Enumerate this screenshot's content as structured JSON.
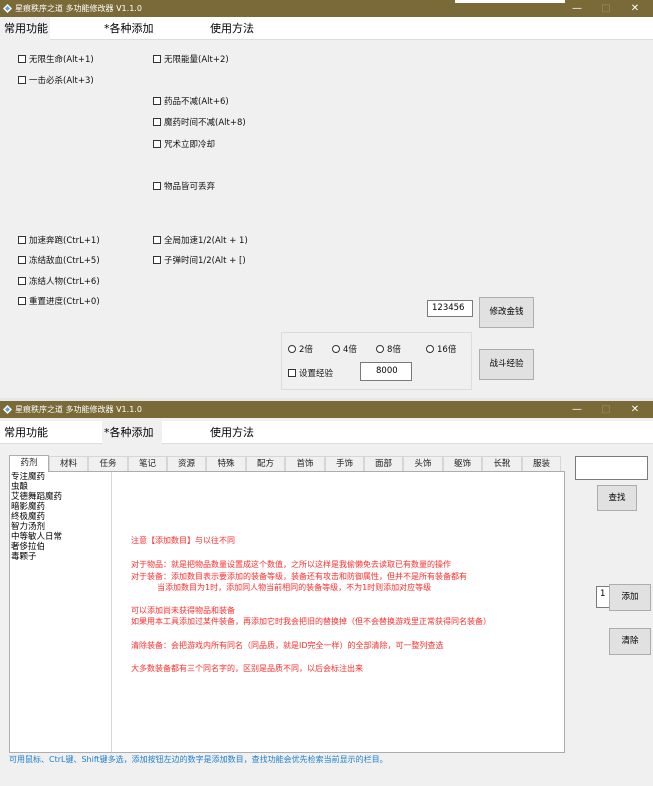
{
  "window1": {
    "title": "星痕秩序之道 多功能修改器 V1.1.0",
    "controls": {
      "minimize": "—",
      "maximize": "□",
      "close": "✕"
    },
    "menu": [
      "常用功能",
      "*各种添加",
      "使用方法"
    ],
    "checkboxes": {
      "infinite_hp": "无限生命(Alt+1)",
      "infinite_energy": "无限能量(Alt+2)",
      "one_hit_kill": "一击必杀(Alt+3)",
      "potion_no_decrease": "药品不减(Alt+6)",
      "potion_time_no_decrease": "魔药时间不减(Alt+8)",
      "spell_no_cooldown": "咒术立即冷却",
      "items_droppable": "物品皆可丢弃",
      "speed_boost": "加速奔跑(CtrL+1)",
      "global_speed": "全局加速1/2(Alt + 1)",
      "freeze_enemy": "冻结敌血(CtrL+5)",
      "bullet_time": "子弹时间1/2(Alt + [)",
      "freeze_npc": "冻结人物(CtrL+6)",
      "reset_progress": "重置进度(CtrL+0)"
    },
    "money": {
      "value": "123456",
      "button": "修改金钱"
    },
    "multiplier": {
      "options": [
        "2倍",
        "4倍",
        "8倍",
        "16倍"
      ],
      "set_exp_label": "设置经验",
      "exp_value": "8000",
      "button": "战斗经验"
    }
  },
  "window2": {
    "title": "星痕秩序之道 多功能修改器 V1.1.0",
    "controls": {
      "minimize": "—",
      "maximize": "□",
      "close": "✕"
    },
    "menu": [
      "常用功能",
      "*各种添加",
      "使用方法"
    ],
    "tabs": [
      "药剂",
      "材料",
      "任务",
      "笔记",
      "资源",
      "特殊",
      "配方",
      "首饰",
      "手饰",
      "面部",
      "头饰",
      "躯饰",
      "长靴",
      "服装"
    ],
    "list_items": [
      "专注魔药",
      "虫酿",
      "艾德舞蹈魔药",
      "暗影魔药",
      "终极魔药",
      "智力汤剂",
      "中等敏人日常",
      "奢侈拉伯",
      "毒颗子"
    ],
    "search_value": "",
    "search_button": "查找",
    "add_count": "1",
    "add_button": "添加",
    "clear_button": "清除",
    "notes": [
      "注意【添加数目】与以往不同",
      "对于物品：就是把物品数量设置成这个数值，之所以这样是我偷懒免去读取已有数量的操作",
      "对于装备：添加数目表示要添加的装备等级，装备还有攻击和防御属性，但并不是所有装备都有",
      "当添加数目为1时，添加同人物当前相同的装备等级，不为1时则添加对应等级",
      "可以添加尚未获得物品和装备",
      "如果用本工具添加过某件装备，再添加它时我会把旧的替换掉（但不会替换游戏里正常获得同名装备）",
      "清除装备：会把游戏内所有同名（同品质，就是ID完全一样）的全部清除，可一整列查选",
      "大多数装备都有三个同名字的，区别是品质不同，以后会标注出来"
    ],
    "status": "可用鼠标、CtrL键、Shift键多选，添加按钮左边的数字是添加数目，查找功能会优先检索当前显示的栏目。"
  },
  "colors": {
    "titlebar": "#7a6a38",
    "note_red": "#ff2d2d",
    "status_blue": "#1c7fd1",
    "window_bg": "#f0f0f0"
  },
  "icons": [
    "app-icon",
    "minimize-icon",
    "maximize-icon",
    "close-icon"
  ]
}
